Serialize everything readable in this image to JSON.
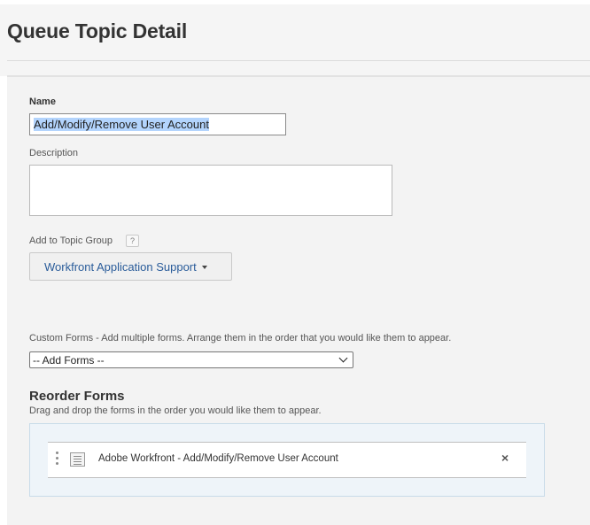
{
  "page": {
    "title": "Queue Topic Detail"
  },
  "name_field": {
    "label": "Name",
    "value": "Add/Modify/Remove User Account"
  },
  "description_field": {
    "label": "Description",
    "value": ""
  },
  "topic_group": {
    "label": "Add to Topic Group",
    "help": "?",
    "selected": "Workfront Application Support"
  },
  "custom_forms": {
    "label": "Custom Forms - Add multiple forms. Arrange them in the order that you would like them to appear.",
    "selected": "-- Add Forms --"
  },
  "reorder": {
    "title": "Reorder Forms",
    "hint": "Drag and drop the forms in the order you would like them to appear.",
    "items": [
      {
        "label": "Adobe Workfront - Add/Modify/Remove User Account",
        "icon": "form-icon",
        "remove": "×"
      }
    ]
  }
}
